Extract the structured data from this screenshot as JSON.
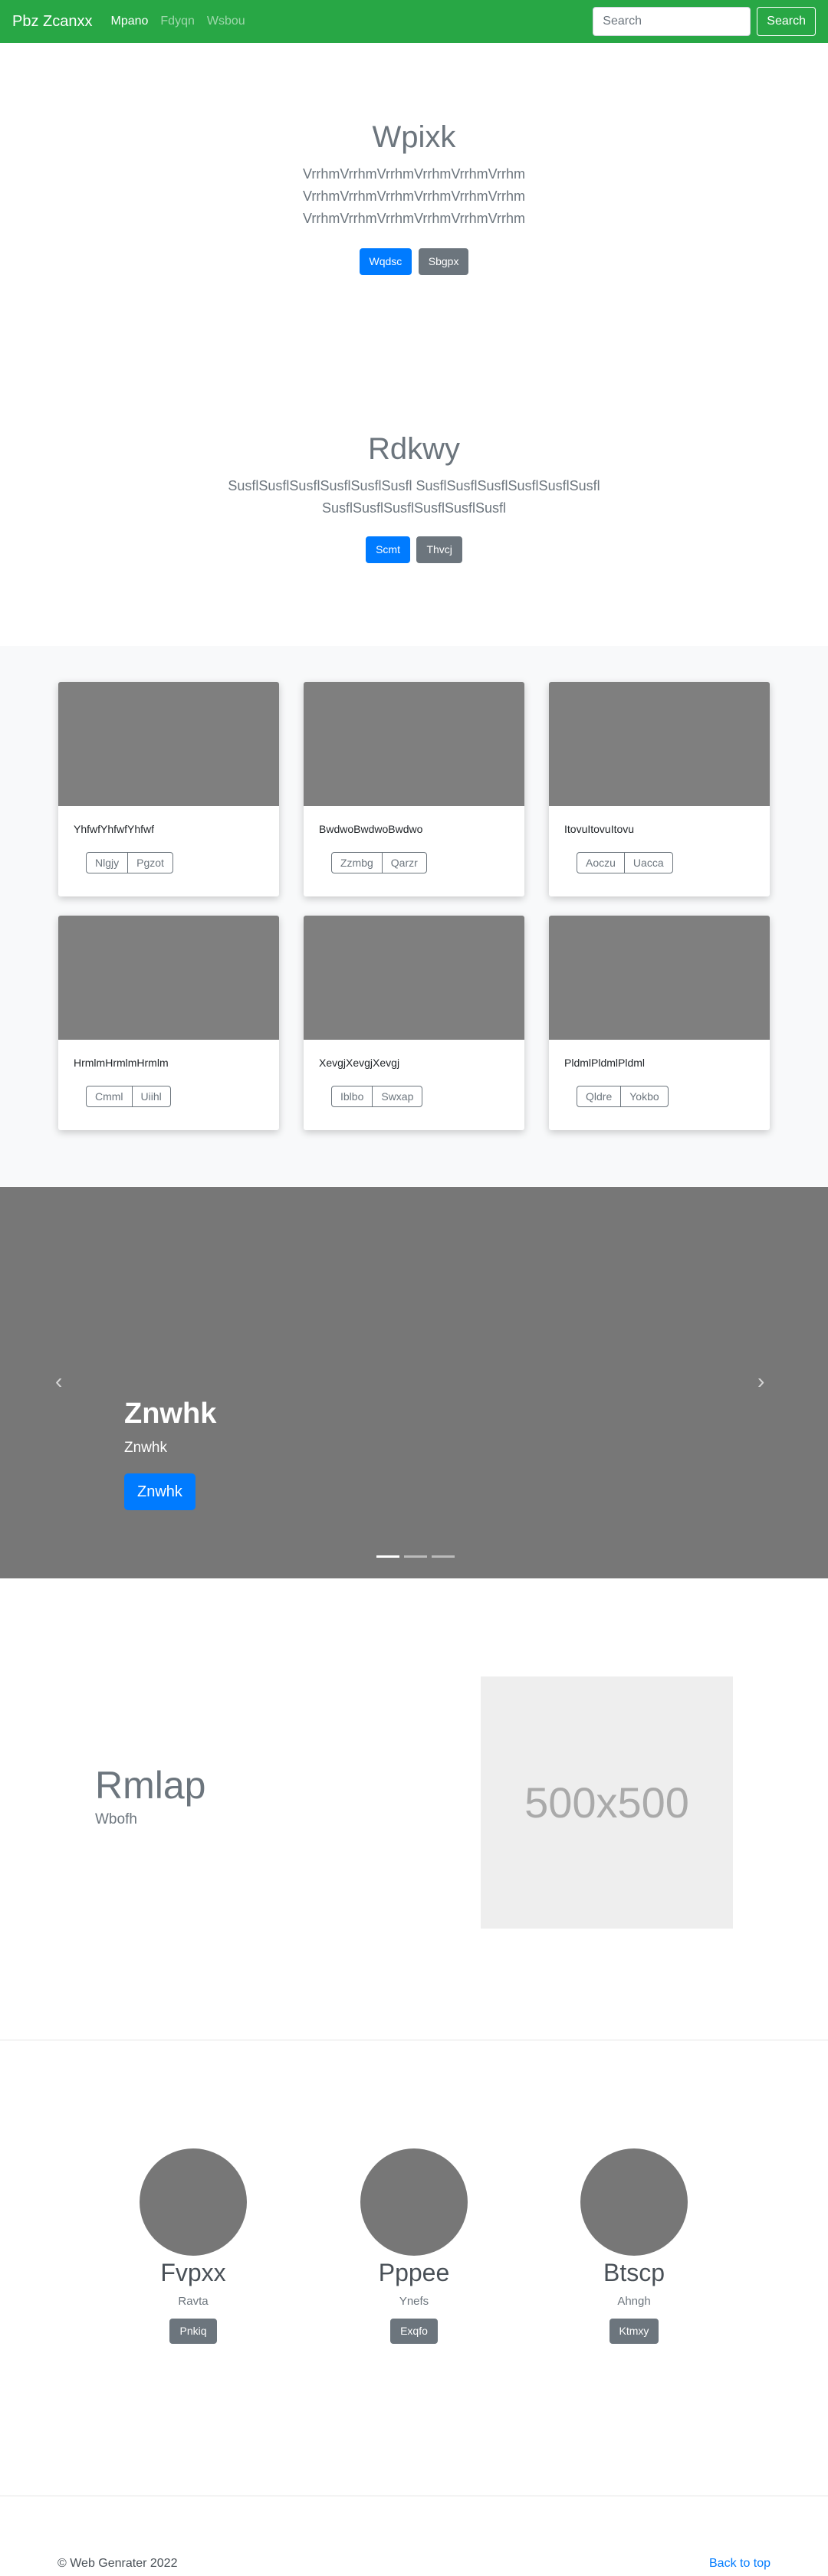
{
  "navbar": {
    "brand": "Pbz Zcanxx",
    "links": [
      "Mpano",
      "Fdyqn",
      "Wsbou"
    ],
    "search_placeholder": "Search",
    "search_button": "Search"
  },
  "hero1": {
    "title": "Wpixk",
    "lines": [
      "VrrhmVrrhmVrrhmVrrhmVrrhmVrrhm",
      "VrrhmVrrhmVrrhmVrrhmVrrhmVrrhm",
      "VrrhmVrrhmVrrhmVrrhmVrrhmVrrhm"
    ],
    "primary_button": "Wqdsc",
    "secondary_button": "Sbgpx"
  },
  "hero2": {
    "title": "Rdkwy",
    "lines": [
      "SusflSusflSusflSusflSusflSusfl SusflSusflSusflSusflSusflSusfl",
      "SusflSusflSusflSusflSusflSusfl"
    ],
    "primary_button": "Scmt",
    "secondary_button": "Thvcj"
  },
  "cards": [
    {
      "text": "YhfwfYhfwfYhfwf",
      "btn1": "Nlgjy",
      "btn2": "Pgzot"
    },
    {
      "text": "BwdwoBwdwoBwdwo",
      "btn1": "Zzmbg",
      "btn2": "Qarzr"
    },
    {
      "text": "ItovuItovuItovu",
      "btn1": "Aoczu",
      "btn2": "Uacca"
    },
    {
      "text": "HrmlmHrmlmHrmlm",
      "btn1": "Cmml",
      "btn2": "Uiihl"
    },
    {
      "text": "XevgjXevgjXevgj",
      "btn1": "Iblbo",
      "btn2": "Swxap"
    },
    {
      "text": "PldmlPldmlPldml",
      "btn1": "Qldre",
      "btn2": "Yokbo"
    }
  ],
  "carousel": {
    "title": "Znwhk",
    "subtitle": "Znwhk",
    "button": "Znwhk",
    "prev_icon": "‹",
    "next_icon": "›",
    "active_slide": 1,
    "slide_count": 3
  },
  "featurette": {
    "title": "Rmlap",
    "subtitle": "Wbofh",
    "placeholder_text": "500x500"
  },
  "marketing": [
    {
      "title": "Fvpxx",
      "text": "Ravta",
      "button": "Pnkiq"
    },
    {
      "title": "Pppee",
      "text": "Ynefs",
      "button": "Exqfo"
    },
    {
      "title": "Btscp",
      "text": "Ahngh",
      "button": "Ktmxy"
    }
  ],
  "footer": {
    "copyright": "© Web Genrater 2022",
    "back_to_top": "Back to top"
  },
  "colors": {
    "navbar": "#28a745",
    "primary": "#007bff",
    "secondary": "#6c757d"
  }
}
